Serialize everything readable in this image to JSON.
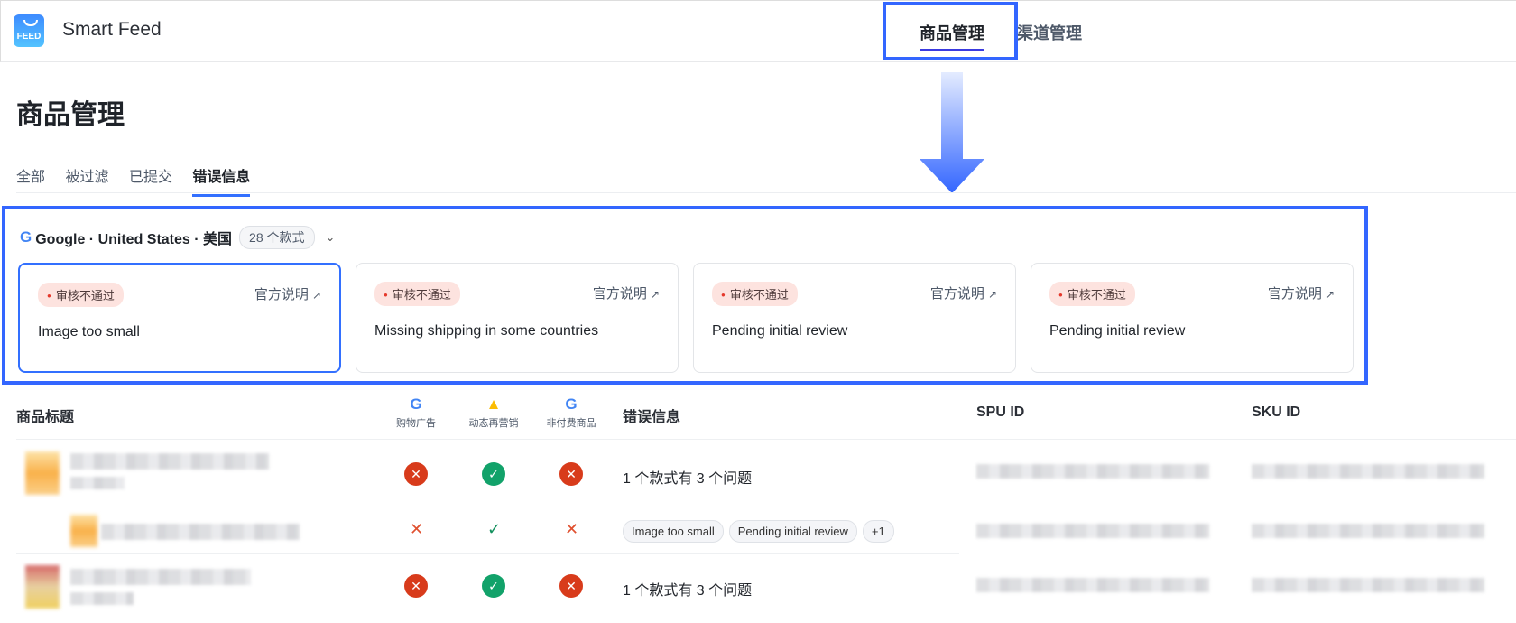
{
  "header": {
    "logo_text": "FEED",
    "app_name": "Smart Feed",
    "nav": [
      {
        "label": "商品管理",
        "active": true
      },
      {
        "label": "渠道管理",
        "active": false
      }
    ]
  },
  "page": {
    "title": "商品管理",
    "tabs": [
      "全部",
      "被过滤",
      "已提交",
      "错误信息"
    ],
    "active_tab": "错误信息"
  },
  "errors": {
    "source": "Google · United States · 美国",
    "count": "28 个款式",
    "cards": [
      {
        "badge": "审核不通过",
        "link": "官方说明",
        "reason": "Image too small"
      },
      {
        "badge": "审核不通过",
        "link": "官方说明",
        "reason": "Missing shipping in some countries"
      },
      {
        "badge": "审核不通过",
        "link": "官方说明",
        "reason": "Pending initial review"
      },
      {
        "badge": "审核不通过",
        "link": "官方说明",
        "reason": "Pending initial review"
      }
    ]
  },
  "table": {
    "columns": {
      "title": "商品标题",
      "ch1": "购物广告",
      "ch2": "动态再营销",
      "ch3": "非付费商品",
      "error": "错误信息",
      "spu": "SPU ID",
      "sku": "SKU ID"
    },
    "rows": [
      {
        "status": [
          "fail",
          "pass",
          "fail"
        ],
        "message": "1 个款式有 3 个问题"
      },
      {
        "status": [
          "fail",
          "pass",
          "fail"
        ],
        "chips": [
          "Image too small",
          "Pending initial review",
          "+1"
        ]
      },
      {
        "status": [
          "fail",
          "pass",
          "fail"
        ],
        "message": "1 个款式有 3 个问题"
      }
    ]
  },
  "colors": {
    "accent": "#3370ff",
    "highlight": "#3366ff",
    "fail": "#d83b1b",
    "pass": "#12a26a"
  }
}
